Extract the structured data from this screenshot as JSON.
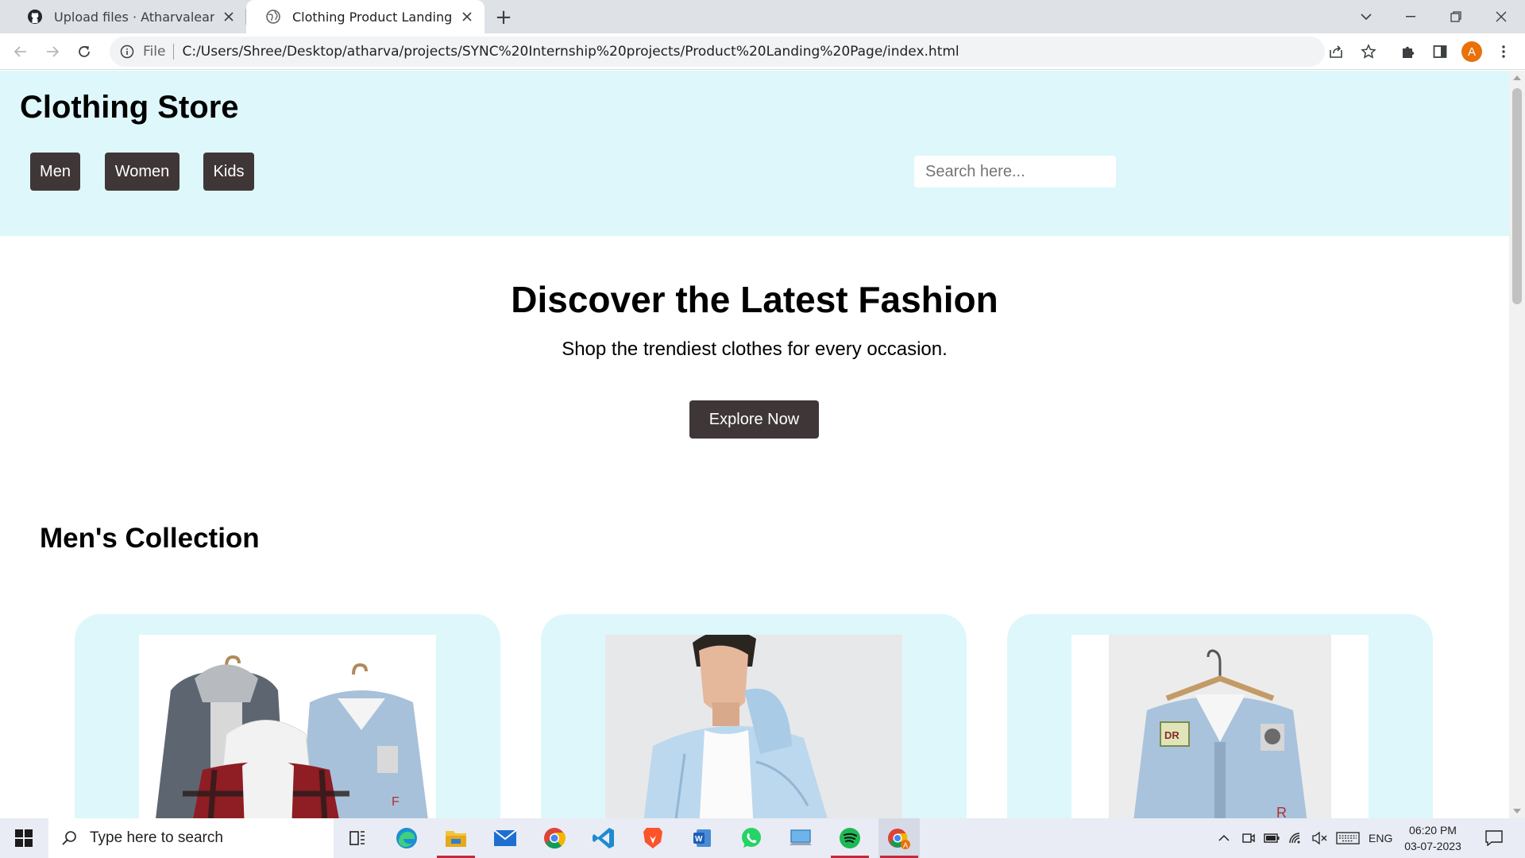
{
  "browser": {
    "tabs": [
      {
        "label": "Upload files · Atharvalearner/SYN",
        "icon": "github-icon",
        "active": false
      },
      {
        "label": "Clothing Product Landing Page",
        "icon": "globe-icon",
        "active": true
      }
    ],
    "new_tab_symbol": "+",
    "address_prefix": "File",
    "url": "C:/Users/Shree/Desktop/atharva/projects/SYNC%20Internship%20projects/Product%20Landing%20Page/index.html",
    "avatar_letter": "A"
  },
  "page": {
    "header": {
      "title": "Clothing Store",
      "nav": [
        "Men",
        "Women",
        "Kids"
      ],
      "search_placeholder": "Search here..."
    },
    "hero": {
      "title": "Discover the Latest Fashion",
      "subtitle": "Shop the trendiest clothes for every occasion.",
      "cta": "Explore Now"
    },
    "collection": {
      "title": "Men's Collection",
      "products": [
        {
          "image": "jackets-group-photo"
        },
        {
          "image": "man-in-light-blue-jacket-photo"
        },
        {
          "image": "denim-jacket-on-hanger-photo"
        }
      ]
    },
    "colors": {
      "header_bg": "#def7fa",
      "button_bg": "#3f3737",
      "card_bg": "#def7fa"
    }
  },
  "taskbar": {
    "search_placeholder": "Type here to search",
    "apps": [
      "task-view-icon",
      "edge-icon",
      "file-explorer-icon",
      "mail-icon",
      "chrome-icon",
      "vscode-icon",
      "brave-icon",
      "word-icon",
      "whatsapp-icon",
      "pc-icon",
      "spotify-icon",
      "chrome-profile-icon"
    ],
    "language": "ENG",
    "time": "06:20 PM",
    "date": "03-07-2023"
  }
}
